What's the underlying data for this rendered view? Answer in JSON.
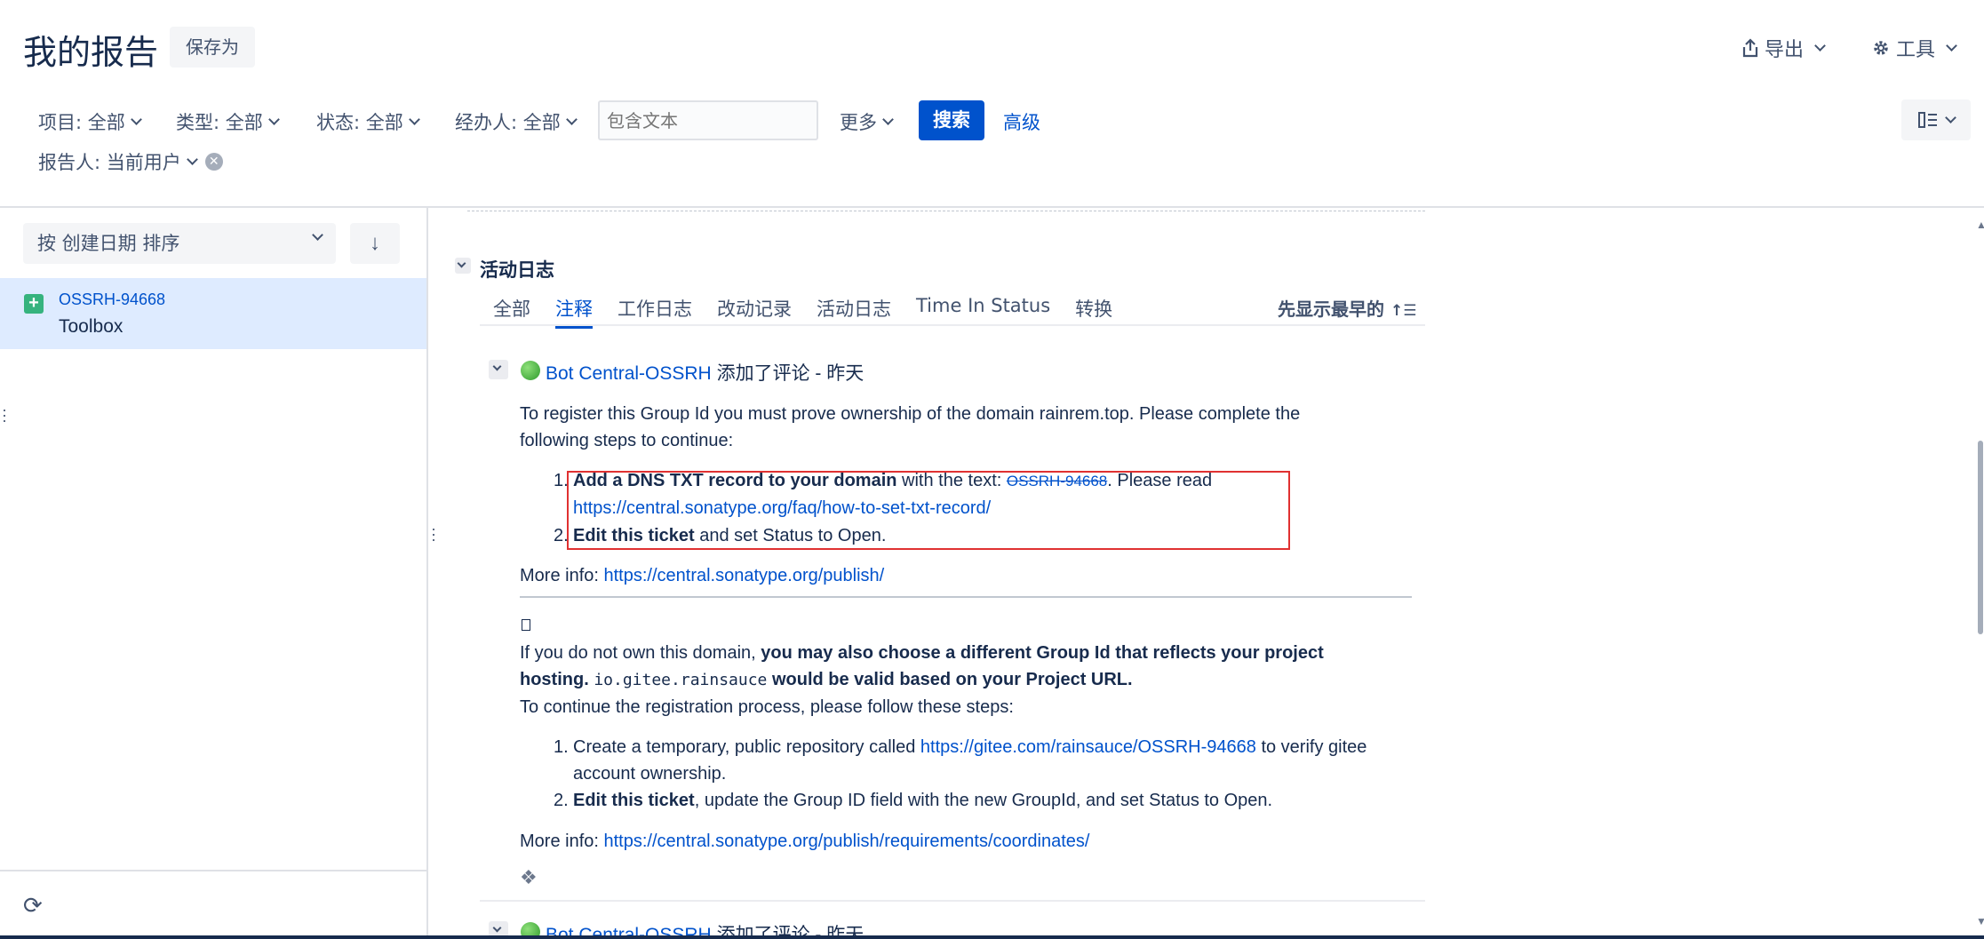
{
  "header": {
    "title": "我的报告",
    "save_as": "保存为",
    "export": "导出",
    "tools": "工具"
  },
  "filters": {
    "project": "项目: 全部",
    "type": "类型: 全部",
    "status": "状态: 全部",
    "assignee": "经办人: 全部",
    "search_placeholder": "包含文本",
    "more": "更多",
    "search_button": "搜索",
    "advanced": "高级",
    "reporter": "报告人: 当前用户"
  },
  "sidebar": {
    "sort_label": "按 创建日期 排序",
    "issue": {
      "key": "OSSRH-94668",
      "summary": "Toolbox"
    }
  },
  "activity": {
    "section_title": "活动日志",
    "tabs": [
      "全部",
      "注释",
      "工作日志",
      "改动记录",
      "活动日志",
      "Time In Status",
      "转换"
    ],
    "active_tab": "注释",
    "order_toggle": "先显示最早的",
    "comment": {
      "author": "Bot Central-OSSRH",
      "action": " 添加了评论 - 昨天",
      "intro_1": "To register this Group Id you must prove ownership of the domain rainrem.top. Please complete the",
      "intro_2": "following steps to continue:",
      "step1_bold": "Add a DNS TXT record to your domain",
      "step1_text": " with the text: ",
      "step1_code": "OSSRH-94668",
      "step1_after": ". Please read",
      "step1_link": "https://central.sonatype.org/faq/how-to-set-txt-record/",
      "step2_bold": "Edit this ticket",
      "step2_text": " and set Status to Open.",
      "more_info_label": "More info: ",
      "more_info_link": "https://central.sonatype.org/publish/",
      "alt_1_prefix": "If you do not own this domain, ",
      "alt_1_bold": "you may also choose a different Group Id that reflects your project",
      "alt_2_bold_a": "hosting. ",
      "alt_2_code": "io.gitee.rainsauce",
      "alt_2_bold_b": " would be valid based on your Project URL.",
      "alt_3": "To continue the registration process, please follow these steps:",
      "alt_step1_text": "Create a temporary, public repository called ",
      "alt_step1_link": "https://gitee.com/rainsauce/OSSRH-94668",
      "alt_step1_after": " to verify gitee",
      "alt_step1_line2": "account ownership.",
      "alt_step2_bold": "Edit this ticket",
      "alt_step2_text": ", update the Group ID field with the new GroupId, and set Status to Open.",
      "more_info2_link": "https://central.sonatype.org/publish/requirements/coordinates/"
    },
    "next_comment": {
      "author": "Bot Central-OSSRH",
      "action": " 添加了评论 - 昨天"
    }
  },
  "colors": {
    "accent": "#0052cc",
    "highlight_box": "#e03131",
    "selected_row": "#deebff"
  }
}
